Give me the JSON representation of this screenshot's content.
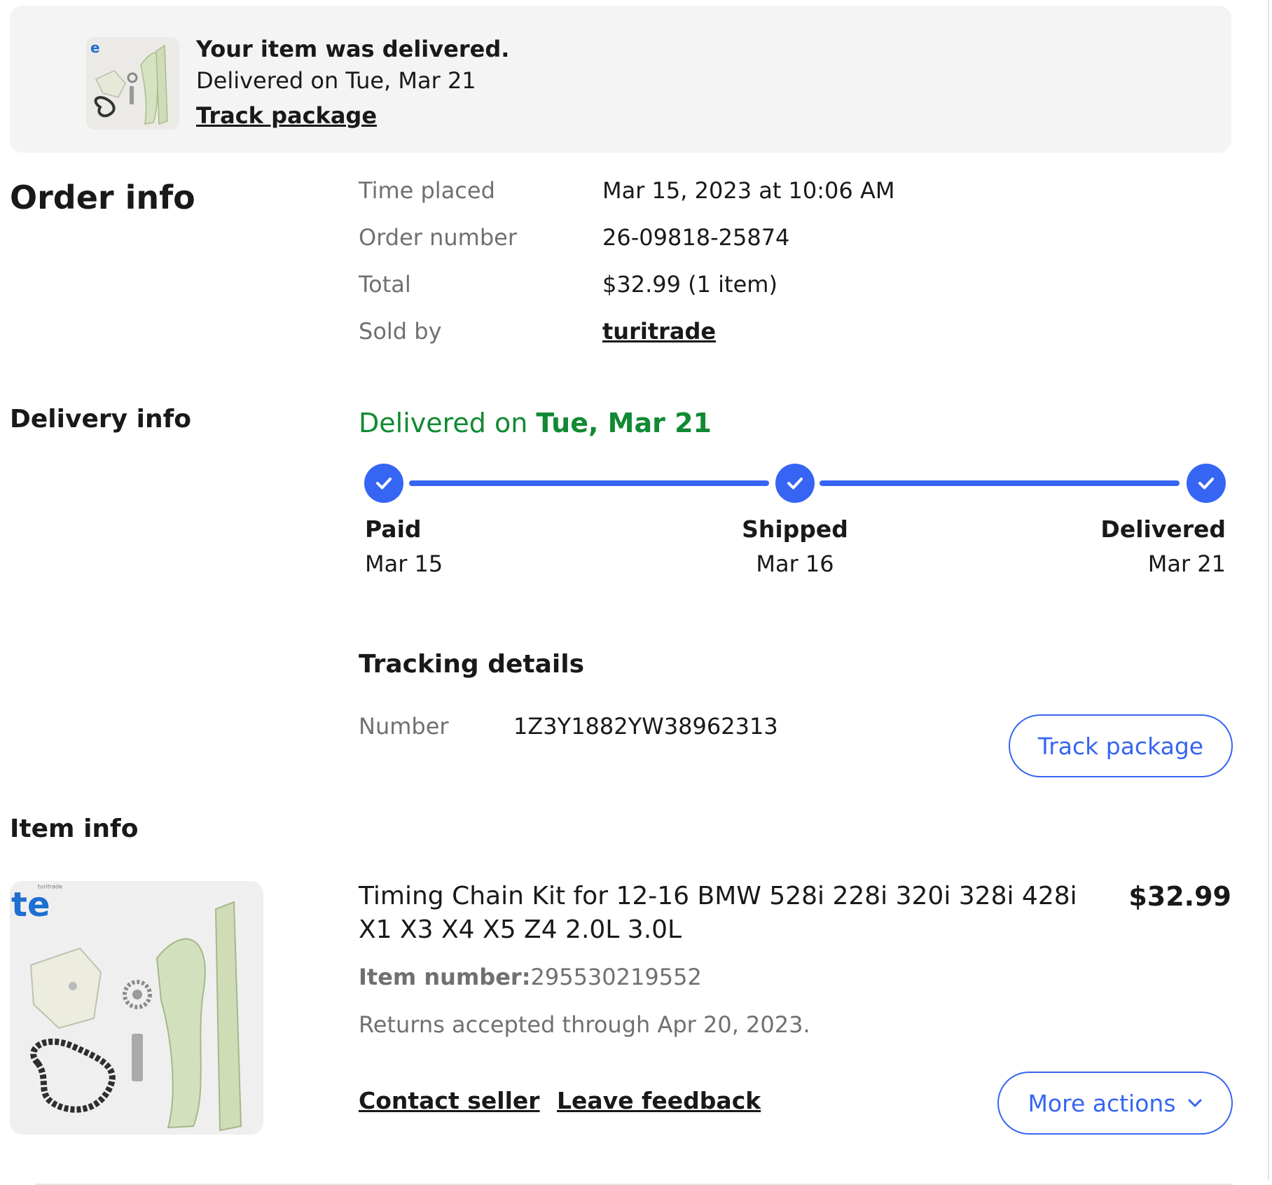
{
  "banner": {
    "logo_text": "e",
    "title": "Your item was delivered.",
    "subtitle": "Delivered on Tue, Mar 21",
    "track_link": "Track package"
  },
  "order_info": {
    "heading": "Order info",
    "rows": [
      {
        "label": "Time placed",
        "value": "Mar 15, 2023 at 10:06 AM"
      },
      {
        "label": "Order number",
        "value": "26-09818-25874"
      },
      {
        "label": "Total",
        "value": "$32.99 (1 item)"
      },
      {
        "label": "Sold by",
        "value": "turitrade"
      }
    ]
  },
  "delivery_info": {
    "heading": "Delivery info",
    "status_prefix": "Delivered on",
    "status_date": "Tue, Mar 21",
    "steps": [
      {
        "label": "Paid",
        "date": "Mar 15"
      },
      {
        "label": "Shipped",
        "date": "Mar 16"
      },
      {
        "label": "Delivered",
        "date": "Mar 21"
      }
    ],
    "progress_completed_steps": 3,
    "accent_color": "#3665f3",
    "status_color": "#118a33"
  },
  "tracking": {
    "heading": "Tracking details",
    "number_label": "Number",
    "number": "1Z3Y1882YW38962313",
    "track_button": "Track package"
  },
  "item_info": {
    "heading": "Item info",
    "image_brand": "te",
    "image_brand_small": "turitrade",
    "title": "Timing Chain Kit for 12-16 BMW 528i 228i 320i 328i 428i X1 X3 X4 X5 Z4 2.0L 3.0L",
    "price": "$32.99",
    "item_number_label": "Item number:",
    "item_number": "295530219552",
    "returns": "Returns accepted through Apr 20, 2023.",
    "contact_seller": "Contact seller",
    "leave_feedback": "Leave feedback",
    "more_actions": "More actions",
    "more_actions_icon": "chevron-down-icon"
  }
}
